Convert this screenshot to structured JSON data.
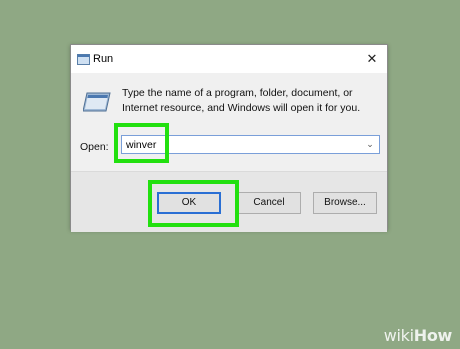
{
  "window": {
    "title": "Run",
    "close_glyph": "✕",
    "icon": "run-icon"
  },
  "main": {
    "description": "Type the name of a program, folder, document, or Internet resource, and Windows will open it for you.",
    "open_label": "Open:",
    "open_value": "winver",
    "dropdown_glyph": "⌄"
  },
  "buttons": {
    "ok": "OK",
    "cancel": "Cancel",
    "browse": "Browse..."
  },
  "watermark": {
    "wiki": "wiki",
    "how": "How"
  },
  "colors": {
    "highlight": "#22e00f",
    "background": "#8fa884",
    "focus_border": "#2a6fd4"
  }
}
